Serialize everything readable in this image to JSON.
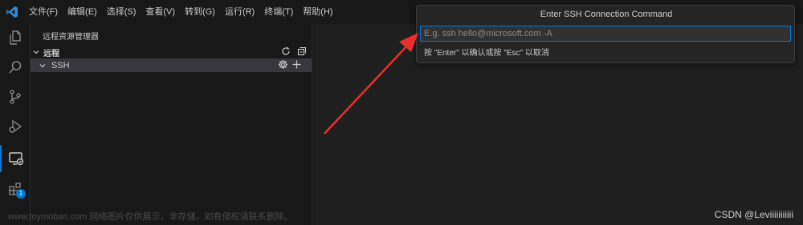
{
  "menu": {
    "items": [
      "文件(F)",
      "编辑(E)",
      "选择(S)",
      "查看(V)",
      "转到(G)",
      "运行(R)",
      "终端(T)",
      "帮助(H)"
    ]
  },
  "activity": {
    "icons": [
      "files-icon",
      "search-icon",
      "source-control-icon",
      "run-debug-icon",
      "remote-explorer-icon",
      "extensions-icon"
    ],
    "extensions_badge": "1"
  },
  "sidebar": {
    "title": "远程资源管理器",
    "section_label": "远程",
    "ssh_label": "SSH"
  },
  "quick_input": {
    "title": "Enter SSH Connection Command",
    "placeholder": "E.g. ssh hello@microsoft.com -A",
    "hint": "按 \"Enter\" 以确认或按 \"Esc\" 以取消"
  },
  "watermark": {
    "left": "www.toymoban.com 网络图片仅供展示，非存储，如有侵权请联系删除。",
    "right": "CSDN @Leviiiiiiiiiii"
  },
  "colors": {
    "accent": "#0078d4",
    "arrow": "#e8302a"
  }
}
